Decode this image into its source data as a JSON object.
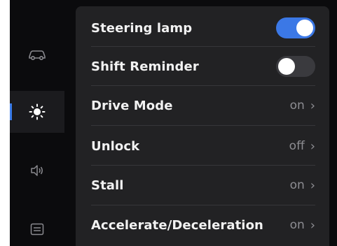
{
  "sidebar": {
    "items": [
      {
        "icon": "car-icon",
        "active": false
      },
      {
        "icon": "brightness-icon",
        "active": true
      },
      {
        "icon": "volume-icon",
        "active": false
      },
      {
        "icon": "settings-panel-icon",
        "active": false
      }
    ],
    "accent": "#3a7be8"
  },
  "settings": {
    "steering_lamp": {
      "label": "Steering lamp",
      "state": "on"
    },
    "shift_reminder": {
      "label": "Shift Reminder",
      "state": "off"
    },
    "drive_mode": {
      "label": "Drive Mode",
      "value": "on"
    },
    "unlock": {
      "label": "Unlock",
      "value": "off"
    },
    "stall": {
      "label": "Stall",
      "value": "on"
    },
    "accelerate_deceleration": {
      "label": "Accelerate/Deceleration",
      "value": "on"
    }
  },
  "colors": {
    "toggle_on": "#3b78e6",
    "toggle_off": "#3a3a3e",
    "panel": "#222224",
    "background": "#0b0b0d"
  }
}
